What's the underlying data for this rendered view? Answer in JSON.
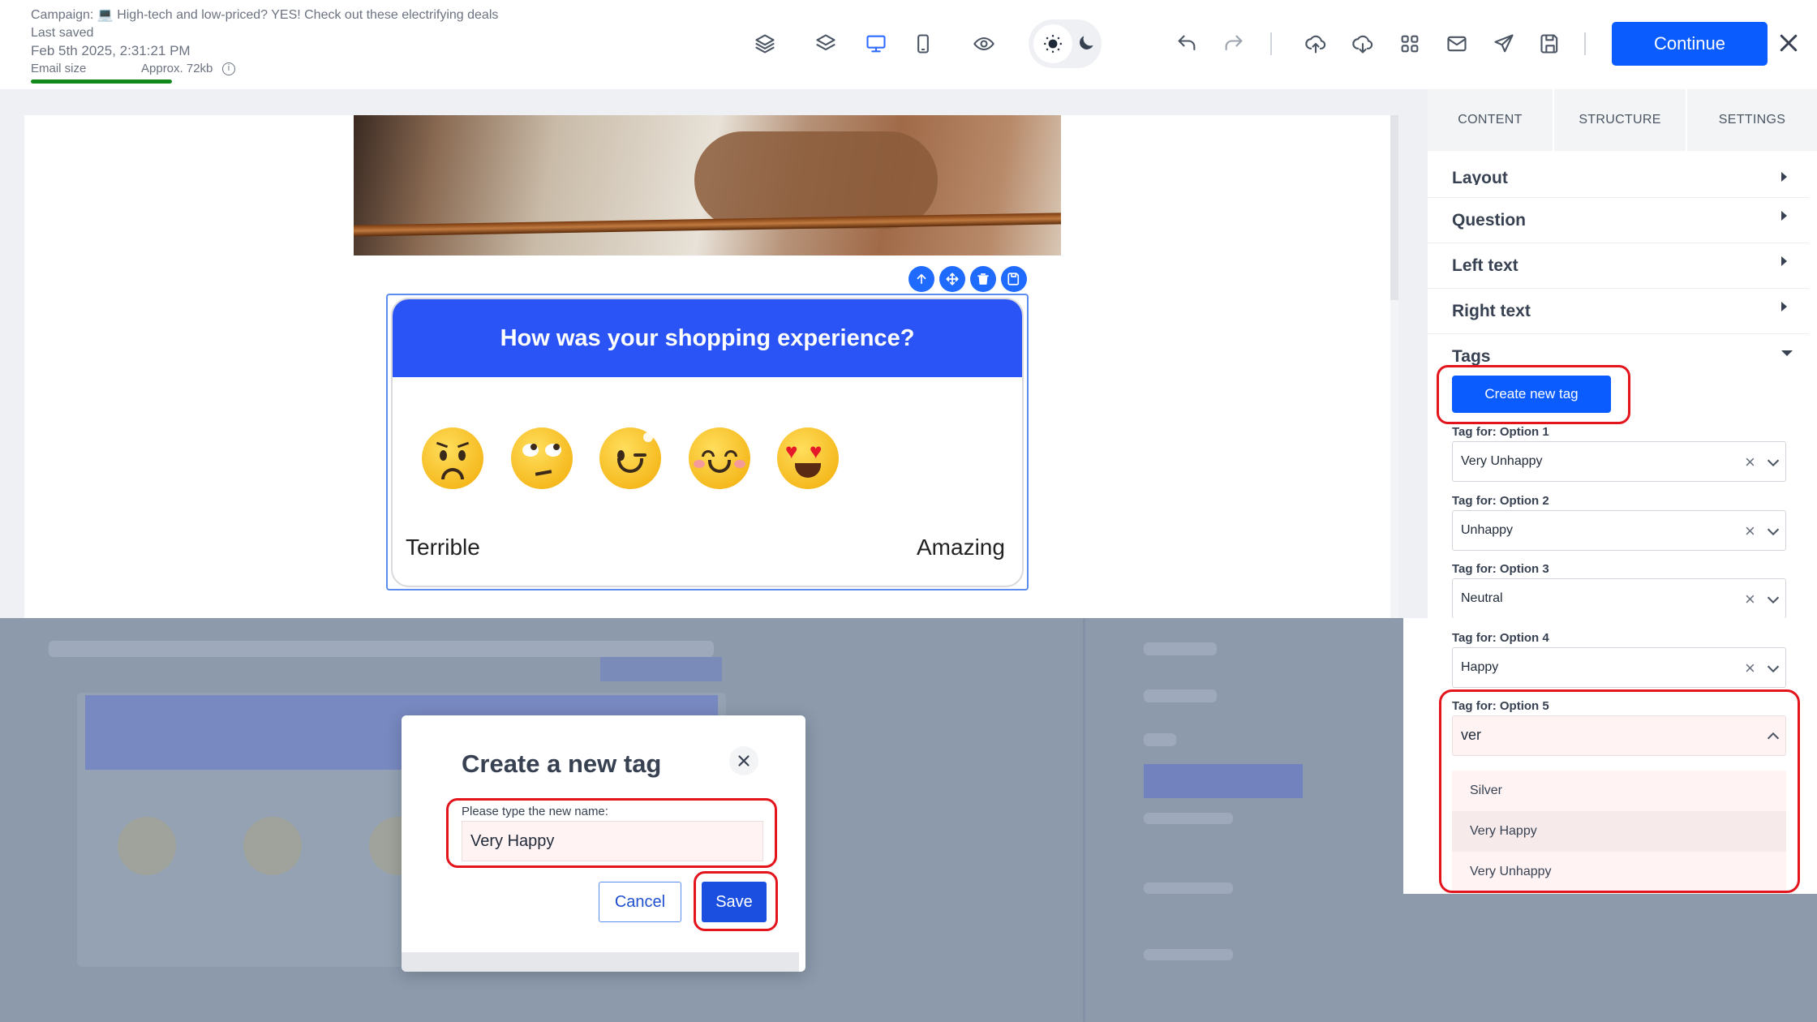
{
  "header": {
    "campaign_line": "Campaign: 💻 High-tech and low-priced? YES! Check out these electrifying deals",
    "last_saved_label": "Last saved",
    "saved_time": "Feb 5th 2025, 2:31:21 PM",
    "email_size_label": "Email size",
    "email_size_value": "Approx. 72kb",
    "email_size_fill": 0.6,
    "continue_label": "Continue"
  },
  "toolbar": {
    "icons": [
      "stack-icon",
      "layers-icon",
      "desktop-icon",
      "mobile-icon",
      "preview-eye-icon",
      "sun-icon",
      "moon-icon",
      "undo-icon",
      "redo-icon",
      "upload-icon",
      "download-icon",
      "apps-grid-icon",
      "mail-icon",
      "send-icon",
      "save-icon",
      "close-icon"
    ],
    "active_view": "desktop"
  },
  "survey": {
    "question": "How was your shopping experience?",
    "left_label": "Terrible",
    "right_label": "Amazing",
    "emojis": [
      "worried-face",
      "eye-roll-face",
      "winking-face",
      "smiling-face",
      "heart-eyes-face"
    ]
  },
  "panel": {
    "tabs": [
      "CONTENT",
      "STRUCTURE",
      "SETTINGS"
    ],
    "sections": [
      "Layout",
      "Question",
      "Left text",
      "Right text",
      "Tags"
    ],
    "create_tag_label": "Create new tag",
    "tags": [
      {
        "label": "Tag for: Option 1",
        "value": "Very Unhappy"
      },
      {
        "label": "Tag for: Option 2",
        "value": "Unhappy"
      },
      {
        "label": "Tag for: Option 3",
        "value": "Neutral"
      },
      {
        "label": "Tag for: Option 4",
        "value": "Happy"
      },
      {
        "label": "Tag for: Option 5",
        "value": "ver"
      }
    ],
    "dropdown_options": [
      "Silver",
      "Very Happy",
      "Very Unhappy"
    ],
    "dropdown_highlighted": "Very Happy"
  },
  "modal": {
    "title": "Create a new tag",
    "field_label": "Please type the new name:",
    "field_value": "Very Happy",
    "cancel_label": "Cancel",
    "save_label": "Save"
  },
  "colors": {
    "primary": "#0a5cff",
    "survey_header": "#2a54f5",
    "highlight_red": "#e3141c",
    "size_bar_green": "#12891b",
    "overlay": "#8c9aac"
  }
}
